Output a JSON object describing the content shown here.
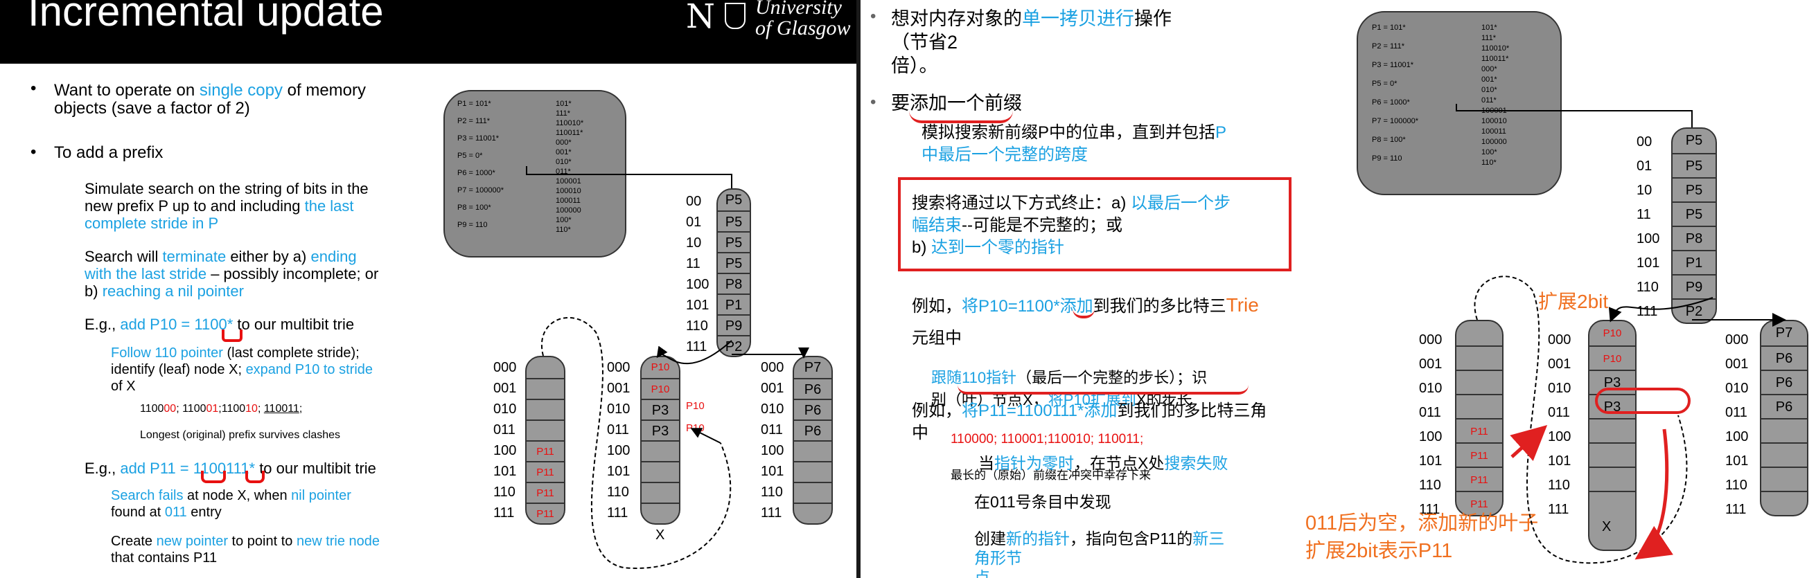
{
  "left": {
    "title": "Incremental update",
    "logo": {
      "line1": "University",
      "line2": "of Glasgow",
      "glyph": "N"
    },
    "bullet1": {
      "a": "Want to operate on ",
      "b": "single copy",
      "c": " of memory",
      "d": "objects (save a factor of 2)"
    },
    "bullet2": "To add a prefix",
    "sub1": {
      "a": "Simulate search on the string of bits in the",
      "b": "new prefix P up to and including ",
      "c": "the last",
      "d": "complete stride in P"
    },
    "sub2": {
      "a": "Search will ",
      "b": "terminate",
      "c": " either by a) ",
      "d": "ending",
      "e": "with the last stride",
      "f": " – possibly incomplete; or",
      "g": "b) ",
      "h": "reaching a nil pointer"
    },
    "sub3": {
      "a": "E.g., ",
      "b": "add P10 = 1100*",
      "c": " to our multibit trie"
    },
    "sub3a": {
      "a": "Follow 110 pointer",
      "b": " (last complete stride);",
      "c": "identify (leaf) node X; ",
      "d": "expand P10 to stride",
      "e": "of X"
    },
    "sub3b": {
      "a": "1100",
      "b": "00",
      "c": "; 1100",
      "d": "01",
      "e": ";1100",
      "f": "10",
      "g": "; ",
      "h": "110011",
      "i": ";"
    },
    "sub3c": "Longest (original) prefix survives clashes",
    "sub4": {
      "a": "E.g., ",
      "b": "add P11 = 1100111*",
      "c": " to our multibit trie"
    },
    "sub4a": {
      "a": "Search fails",
      "b": " at node X, when ",
      "c": "nil pointer",
      "d": "found at ",
      "e": "011",
      "f": " entry"
    },
    "sub4b": {
      "a": "Create ",
      "b": "new pointer",
      "c": " to point to ",
      "d": "new trie node",
      "e": "that contains P11"
    },
    "x_label": "X"
  },
  "table": {
    "prefixes": [
      "P1 = 101*",
      "P2 = 111*",
      "P3 = 11001*",
      "P5 = 0*",
      "P6 = 1000*",
      "P7 = 100000*",
      "P8 = 100*",
      "P9 = 110"
    ],
    "expansions": [
      "101*",
      "111*",
      "110010*",
      "110011*",
      "000*",
      "001*",
      "010*",
      "011*",
      "100001",
      "100010",
      "100011",
      "100000",
      "100*",
      "110*"
    ]
  },
  "root_node": {
    "labels": [
      "00",
      "01",
      "10",
      "11",
      "100",
      "101",
      "110",
      "111"
    ],
    "cells": [
      "P5",
      "P5",
      "P5",
      "P5",
      "P8",
      "P1",
      "P9",
      "P2"
    ]
  },
  "node_p11": {
    "labels": [
      "000",
      "001",
      "010",
      "011",
      "100",
      "101",
      "110",
      "111"
    ],
    "cells": [
      "",
      "",
      "",
      "",
      "P11",
      "P11",
      "P11",
      "P11"
    ]
  },
  "node_x": {
    "labels": [
      "000",
      "001",
      "010",
      "011",
      "100",
      "101",
      "110",
      "111"
    ],
    "cells": [
      "P10",
      "P10",
      "P3",
      "P3",
      "",
      "",
      "",
      ""
    ],
    "side": [
      "",
      "",
      "P10",
      "P10",
      "",
      "",
      "",
      ""
    ]
  },
  "node_p7": {
    "labels": [
      "000",
      "001",
      "010",
      "011",
      "100",
      "101",
      "110",
      "111"
    ],
    "cells": [
      "P7",
      "P6",
      "P6",
      "P6",
      "",
      "",
      "",
      ""
    ]
  },
  "right": {
    "l1a": "想对内存对象的",
    "l1b": "单一拷贝进行",
    "l1c": "操作（节省2",
    "l1d": "倍）。",
    "l2a": "要",
    "l2b": "添加一个前缀",
    "s1a": "模拟搜索新前缀P中的位串，直到并包括",
    "s1b": "P",
    "s1c": "中最后一个完整的跨度",
    "box1a": "搜索将通过以下方式终止：a) ",
    "box1b": "以最后一个步",
    "box1c": "幅结束",
    "box1d": "--可能是不完整的；或",
    "box1e": "b) ",
    "box1f": "达到一个零的指针",
    "e1a": "例如，",
    "e1b": "将P10=1100*添加",
    "e1c": "到我们的多比特三",
    "e1d": "Trie",
    "e1e": "元组中",
    "f1a": "跟随",
    "f1b": "110指针",
    "f1c": "（最后一个完整的步长）；识",
    "f1d": "别（叶）节点X，",
    "f1e": "将P10扩展到",
    "f1f": "X的步长",
    "e2a": "例如，",
    "e2b": "将P11=1100111*添加",
    "e2c": "到我们的多比特三角",
    "e2d": "中",
    "g1": "110000; 110001;110010; 110011;",
    "g2": "最长的（原始）前缀在冲突中幸存下来",
    "h1a": "当",
    "h1b": "指针为零时",
    "h1c": "，在节点X处",
    "h1d": "搜索失败",
    "h2": "在011号条目中发现",
    "i1a": "创建",
    "i1b": "新的指针",
    "i1c": "，指向包含P11的",
    "i1d": "新三角形节",
    "i1e": "点",
    "note1": "扩展2bit",
    "note2": "011后为空，添加新的叶子",
    "note3": "扩展2bit表示P11",
    "x_label": "X"
  },
  "colors": {
    "accent_blue": "#1ba1e2",
    "annotation_red": "#e02020",
    "annotation_orange": "#f07020",
    "node_gray": "#9a9a9a"
  }
}
